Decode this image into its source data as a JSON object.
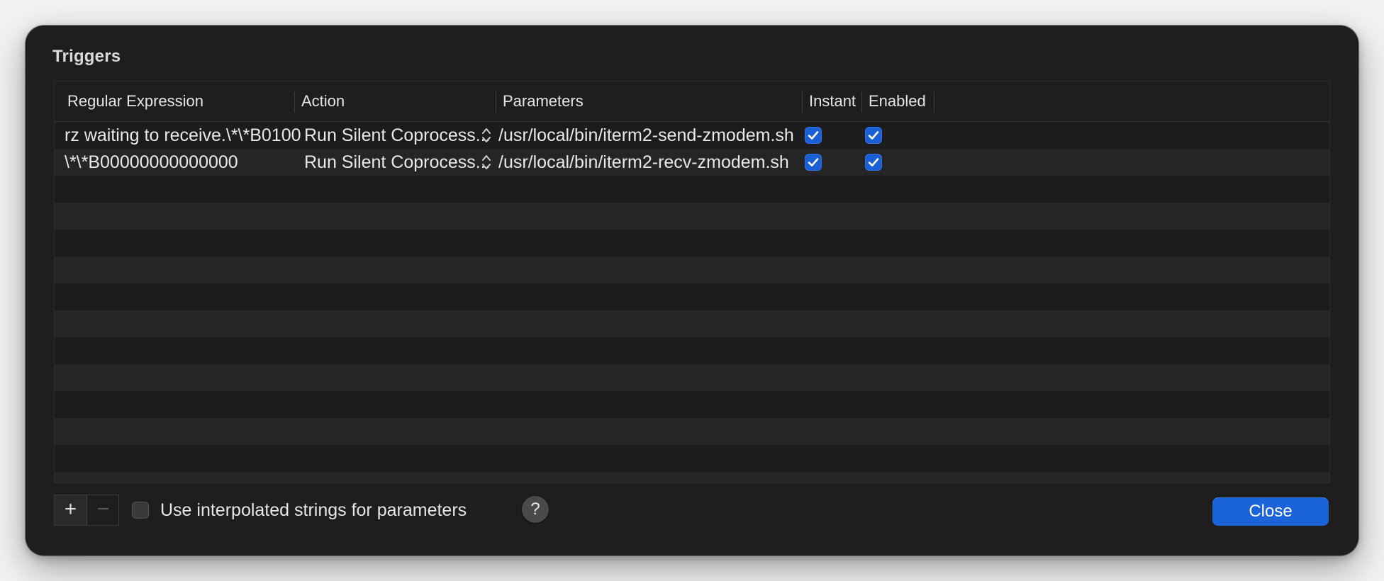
{
  "dialog": {
    "title": "Triggers"
  },
  "table": {
    "columns": [
      "Regular Expression",
      "Action",
      "Parameters",
      "Instant",
      "Enabled"
    ],
    "rows": [
      {
        "regex": "rz waiting to receive.\\*\\*B0100",
        "action": "Run Silent Coprocess...",
        "parameters": "/usr/local/bin/iterm2-send-zmodem.sh",
        "instant": true,
        "enabled": true
      },
      {
        "regex": "\\*\\*B00000000000000",
        "action": "Run Silent Coprocess...",
        "parameters": "/usr/local/bin/iterm2-recv-zmodem.sh",
        "instant": true,
        "enabled": true
      }
    ],
    "empty_row_count": 12
  },
  "footer": {
    "add_label": "+",
    "remove_label": "−",
    "interpolated_label": "Use interpolated strings for parameters",
    "interpolated_checked": false,
    "help_label": "?",
    "close_label": "Close"
  },
  "colors": {
    "accent": "#1b63d8",
    "dialog_bg": "#1e1e1e",
    "row_alt": "#252525"
  }
}
